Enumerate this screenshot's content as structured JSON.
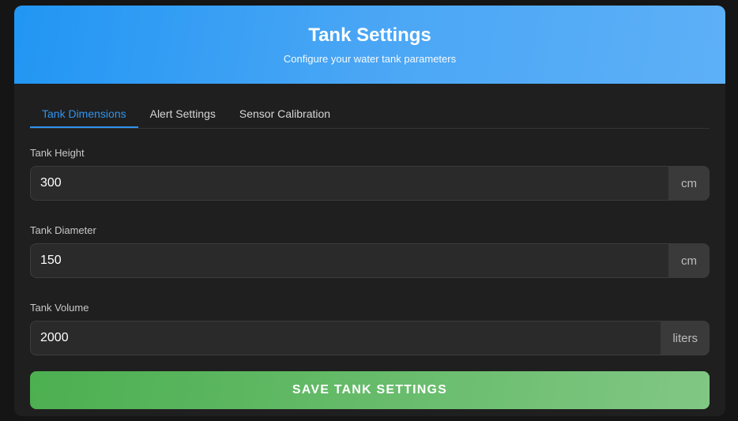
{
  "header": {
    "title": "Tank Settings",
    "subtitle": "Configure your water tank parameters"
  },
  "tabs": [
    {
      "label": "Tank Dimensions",
      "active": true
    },
    {
      "label": "Alert Settings",
      "active": false
    },
    {
      "label": "Sensor Calibration",
      "active": false
    }
  ],
  "fields": [
    {
      "label": "Tank Height",
      "value": "300",
      "unit": "cm"
    },
    {
      "label": "Tank Diameter",
      "value": "150",
      "unit": "cm"
    },
    {
      "label": "Tank Volume",
      "value": "2000",
      "unit": "liters"
    }
  ],
  "actions": {
    "save_label": "SAVE TANK SETTINGS"
  },
  "colors": {
    "header_gradient_start": "#2196f3",
    "header_gradient_end": "#5db0f7",
    "active_tab": "#2f94ef",
    "save_gradient_start": "#4caf50",
    "save_gradient_end": "#81c784",
    "card_background": "#1f1f1f"
  }
}
